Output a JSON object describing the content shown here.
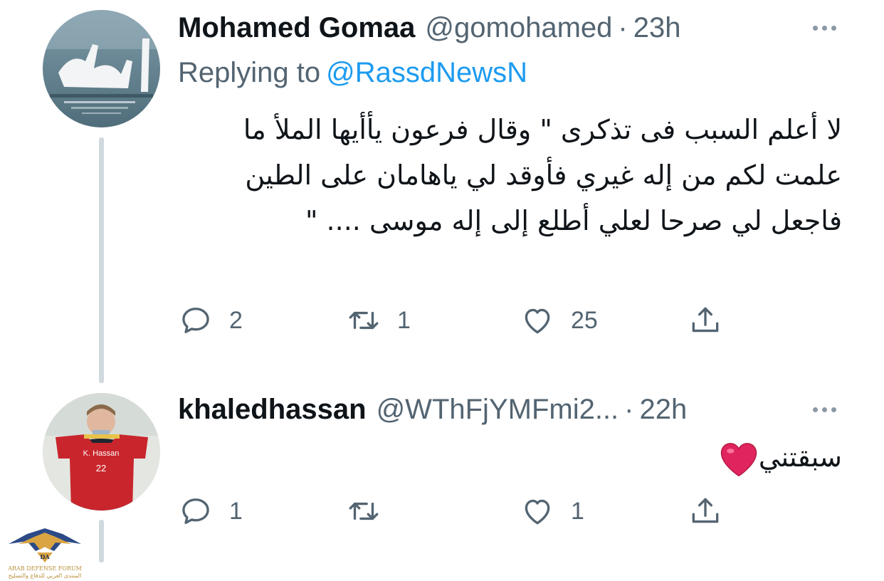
{
  "tweets": [
    {
      "display_name": "Mohamed Gomaa",
      "handle": "@gomohamed",
      "separator": "·",
      "time": "23h",
      "replying_label": "Replying to",
      "replying_to": "@RassdNewsN",
      "text": "لا أعلم السبب فى تذكرى \" وقال فرعون يأأيها الملأ ما علمت لكم من إله غيري فأوقد لي ياهامان على الطين فاجعل لي صرحا لعلي أطلع إلى إله موسى .... \"",
      "avatar_icon": "calligraphy-avatar",
      "actions": {
        "replies": "2",
        "retweets": "1",
        "likes": "25"
      }
    },
    {
      "display_name": "khaledhassan",
      "handle": "@WThFjYMFmi2...",
      "separator": "·",
      "time": "22h",
      "text": "سبقتني",
      "emoji": "red-heart",
      "avatar_icon": "person-holding-jersey-avatar",
      "avatar_jersey_name": "K. Hassan",
      "avatar_jersey_number": "22",
      "actions": {
        "replies": "1",
        "retweets": "",
        "likes": "1"
      }
    }
  ],
  "watermark": {
    "logo_text": "DA",
    "name_en": "ARAB DEFENSE FORUM",
    "name_ar": "المنتدى العربي للدفاع والتسليح"
  },
  "colors": {
    "text_primary": "#0f1419",
    "text_secondary": "#536471",
    "link": "#1d9bf0",
    "thread_line": "#cfd9de",
    "heart": "#e0245e"
  }
}
